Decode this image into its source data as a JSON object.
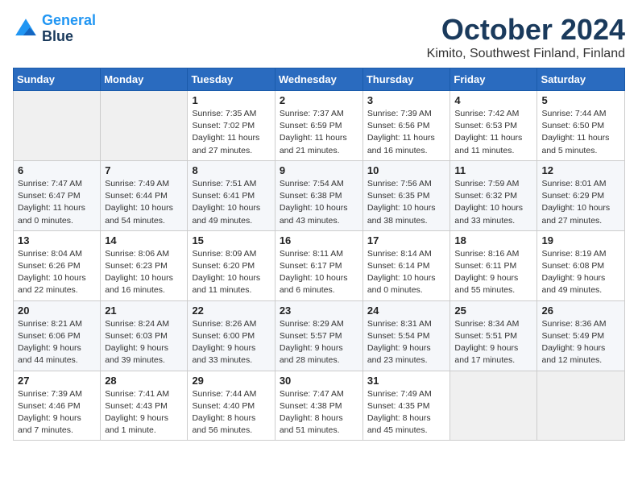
{
  "header": {
    "logo_line1": "General",
    "logo_line2": "Blue",
    "month": "October 2024",
    "location": "Kimito, Southwest Finland, Finland"
  },
  "weekdays": [
    "Sunday",
    "Monday",
    "Tuesday",
    "Wednesday",
    "Thursday",
    "Friday",
    "Saturday"
  ],
  "weeks": [
    [
      {
        "day": "",
        "info": ""
      },
      {
        "day": "",
        "info": ""
      },
      {
        "day": "1",
        "info": "Sunrise: 7:35 AM\nSunset: 7:02 PM\nDaylight: 11 hours\nand 27 minutes."
      },
      {
        "day": "2",
        "info": "Sunrise: 7:37 AM\nSunset: 6:59 PM\nDaylight: 11 hours\nand 21 minutes."
      },
      {
        "day": "3",
        "info": "Sunrise: 7:39 AM\nSunset: 6:56 PM\nDaylight: 11 hours\nand 16 minutes."
      },
      {
        "day": "4",
        "info": "Sunrise: 7:42 AM\nSunset: 6:53 PM\nDaylight: 11 hours\nand 11 minutes."
      },
      {
        "day": "5",
        "info": "Sunrise: 7:44 AM\nSunset: 6:50 PM\nDaylight: 11 hours\nand 5 minutes."
      }
    ],
    [
      {
        "day": "6",
        "info": "Sunrise: 7:47 AM\nSunset: 6:47 PM\nDaylight: 11 hours\nand 0 minutes."
      },
      {
        "day": "7",
        "info": "Sunrise: 7:49 AM\nSunset: 6:44 PM\nDaylight: 10 hours\nand 54 minutes."
      },
      {
        "day": "8",
        "info": "Sunrise: 7:51 AM\nSunset: 6:41 PM\nDaylight: 10 hours\nand 49 minutes."
      },
      {
        "day": "9",
        "info": "Sunrise: 7:54 AM\nSunset: 6:38 PM\nDaylight: 10 hours\nand 43 minutes."
      },
      {
        "day": "10",
        "info": "Sunrise: 7:56 AM\nSunset: 6:35 PM\nDaylight: 10 hours\nand 38 minutes."
      },
      {
        "day": "11",
        "info": "Sunrise: 7:59 AM\nSunset: 6:32 PM\nDaylight: 10 hours\nand 33 minutes."
      },
      {
        "day": "12",
        "info": "Sunrise: 8:01 AM\nSunset: 6:29 PM\nDaylight: 10 hours\nand 27 minutes."
      }
    ],
    [
      {
        "day": "13",
        "info": "Sunrise: 8:04 AM\nSunset: 6:26 PM\nDaylight: 10 hours\nand 22 minutes."
      },
      {
        "day": "14",
        "info": "Sunrise: 8:06 AM\nSunset: 6:23 PM\nDaylight: 10 hours\nand 16 minutes."
      },
      {
        "day": "15",
        "info": "Sunrise: 8:09 AM\nSunset: 6:20 PM\nDaylight: 10 hours\nand 11 minutes."
      },
      {
        "day": "16",
        "info": "Sunrise: 8:11 AM\nSunset: 6:17 PM\nDaylight: 10 hours\nand 6 minutes."
      },
      {
        "day": "17",
        "info": "Sunrise: 8:14 AM\nSunset: 6:14 PM\nDaylight: 10 hours\nand 0 minutes."
      },
      {
        "day": "18",
        "info": "Sunrise: 8:16 AM\nSunset: 6:11 PM\nDaylight: 9 hours\nand 55 minutes."
      },
      {
        "day": "19",
        "info": "Sunrise: 8:19 AM\nSunset: 6:08 PM\nDaylight: 9 hours\nand 49 minutes."
      }
    ],
    [
      {
        "day": "20",
        "info": "Sunrise: 8:21 AM\nSunset: 6:06 PM\nDaylight: 9 hours\nand 44 minutes."
      },
      {
        "day": "21",
        "info": "Sunrise: 8:24 AM\nSunset: 6:03 PM\nDaylight: 9 hours\nand 39 minutes."
      },
      {
        "day": "22",
        "info": "Sunrise: 8:26 AM\nSunset: 6:00 PM\nDaylight: 9 hours\nand 33 minutes."
      },
      {
        "day": "23",
        "info": "Sunrise: 8:29 AM\nSunset: 5:57 PM\nDaylight: 9 hours\nand 28 minutes."
      },
      {
        "day": "24",
        "info": "Sunrise: 8:31 AM\nSunset: 5:54 PM\nDaylight: 9 hours\nand 23 minutes."
      },
      {
        "day": "25",
        "info": "Sunrise: 8:34 AM\nSunset: 5:51 PM\nDaylight: 9 hours\nand 17 minutes."
      },
      {
        "day": "26",
        "info": "Sunrise: 8:36 AM\nSunset: 5:49 PM\nDaylight: 9 hours\nand 12 minutes."
      }
    ],
    [
      {
        "day": "27",
        "info": "Sunrise: 7:39 AM\nSunset: 4:46 PM\nDaylight: 9 hours\nand 7 minutes."
      },
      {
        "day": "28",
        "info": "Sunrise: 7:41 AM\nSunset: 4:43 PM\nDaylight: 9 hours\nand 1 minute."
      },
      {
        "day": "29",
        "info": "Sunrise: 7:44 AM\nSunset: 4:40 PM\nDaylight: 8 hours\nand 56 minutes."
      },
      {
        "day": "30",
        "info": "Sunrise: 7:47 AM\nSunset: 4:38 PM\nDaylight: 8 hours\nand 51 minutes."
      },
      {
        "day": "31",
        "info": "Sunrise: 7:49 AM\nSunset: 4:35 PM\nDaylight: 8 hours\nand 45 minutes."
      },
      {
        "day": "",
        "info": ""
      },
      {
        "day": "",
        "info": ""
      }
    ]
  ]
}
